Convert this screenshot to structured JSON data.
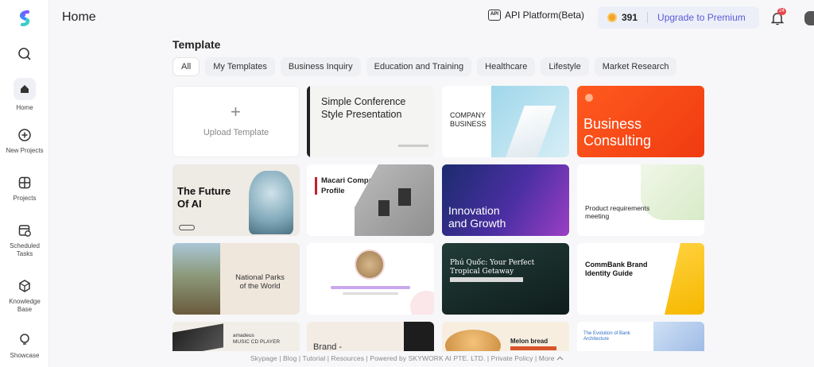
{
  "sidebar": {
    "items": [
      {
        "label": "Home"
      },
      {
        "label": "New Projects"
      },
      {
        "label": "Projects"
      },
      {
        "label": "Scheduled\nTasks"
      },
      {
        "label": "Knowledge\nBase"
      },
      {
        "label": "Showcase"
      }
    ]
  },
  "header": {
    "title": "Home",
    "api_label": "API Platform(Beta)",
    "api_icon_text": "API",
    "credits": "391",
    "upgrade_label": "Upgrade to Premium",
    "notification_count": "24"
  },
  "section": {
    "title": "Template"
  },
  "tabs": [
    {
      "label": "All"
    },
    {
      "label": "My Templates"
    },
    {
      "label": "Business Inquiry"
    },
    {
      "label": "Education and Training"
    },
    {
      "label": "Healthcare"
    },
    {
      "label": "Lifestyle"
    },
    {
      "label": "Market Research"
    }
  ],
  "templates": {
    "upload_label": "Upload Template",
    "t1": "Simple Conference\nStyle Presentation",
    "t2": "COMPANY\nBUSINESS",
    "t3": "Business\nConsulting",
    "t4": "The Future\nOf AI",
    "t5": "Macari Company\nProfile",
    "t6": "Innovation\nand Growth",
    "t7": "Product requirements\nmeeting",
    "t8": "National Parks\nof the World",
    "t9": "",
    "t10": "Phú Quốc: Your Perfect\nTropical Getaway",
    "t11": "CommBank Brand\nIdentity Guide",
    "t12": "amadeus\nMUSIC CD PLAYER",
    "t13": "Brand -",
    "t14": "Melon bread",
    "t15": "The Evolution of Bank\nArchitecture"
  },
  "footer": {
    "text": "Skypage  |  Blog  |  Tutorial  |  Resources  |  Powered by SKYWORK AI PTE. LTD. | Private Policy | More"
  }
}
